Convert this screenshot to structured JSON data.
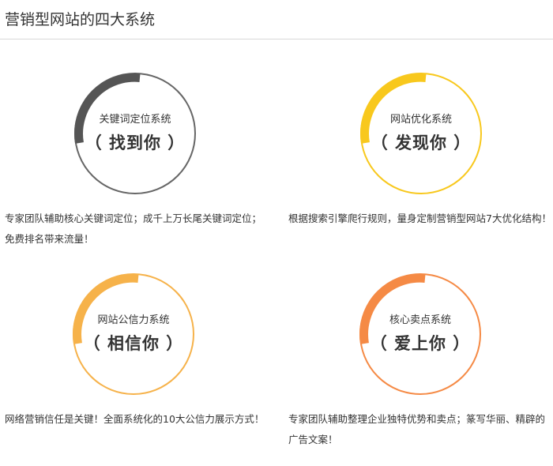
{
  "page_title": "营销型网站的四大系统",
  "systems": [
    {
      "name": "关键词定位系统",
      "slogan": "（ 找到你 ）",
      "description": "专家团队辅助核心关键词定位；成千上万长尾关键词定位；免费排名带来流量！",
      "ring_color": "#666666",
      "arc_color": "#555555"
    },
    {
      "name": "网站优化系统",
      "slogan": "（ 发现你 ）",
      "description": "根据搜索引擎爬行规则，量身定制营销型网站7大优化结构！",
      "ring_color": "#f8c81d",
      "arc_color": "#f8c81d"
    },
    {
      "name": "网站公信力系统",
      "slogan": "（ 相信你 ）",
      "description": "网络营销信任是关键！全面系统化的10大公信力展示方式！",
      "ring_color": "#f6b24a",
      "arc_color": "#f6b24a"
    },
    {
      "name": "核心卖点系统",
      "slogan": "（ 爱上你 ）",
      "description": "专家团队辅助整理企业独特优势和卖点；篆写华丽、精辟的广告文案！",
      "ring_color": "#f58a45",
      "arc_color": "#f58a45"
    }
  ]
}
